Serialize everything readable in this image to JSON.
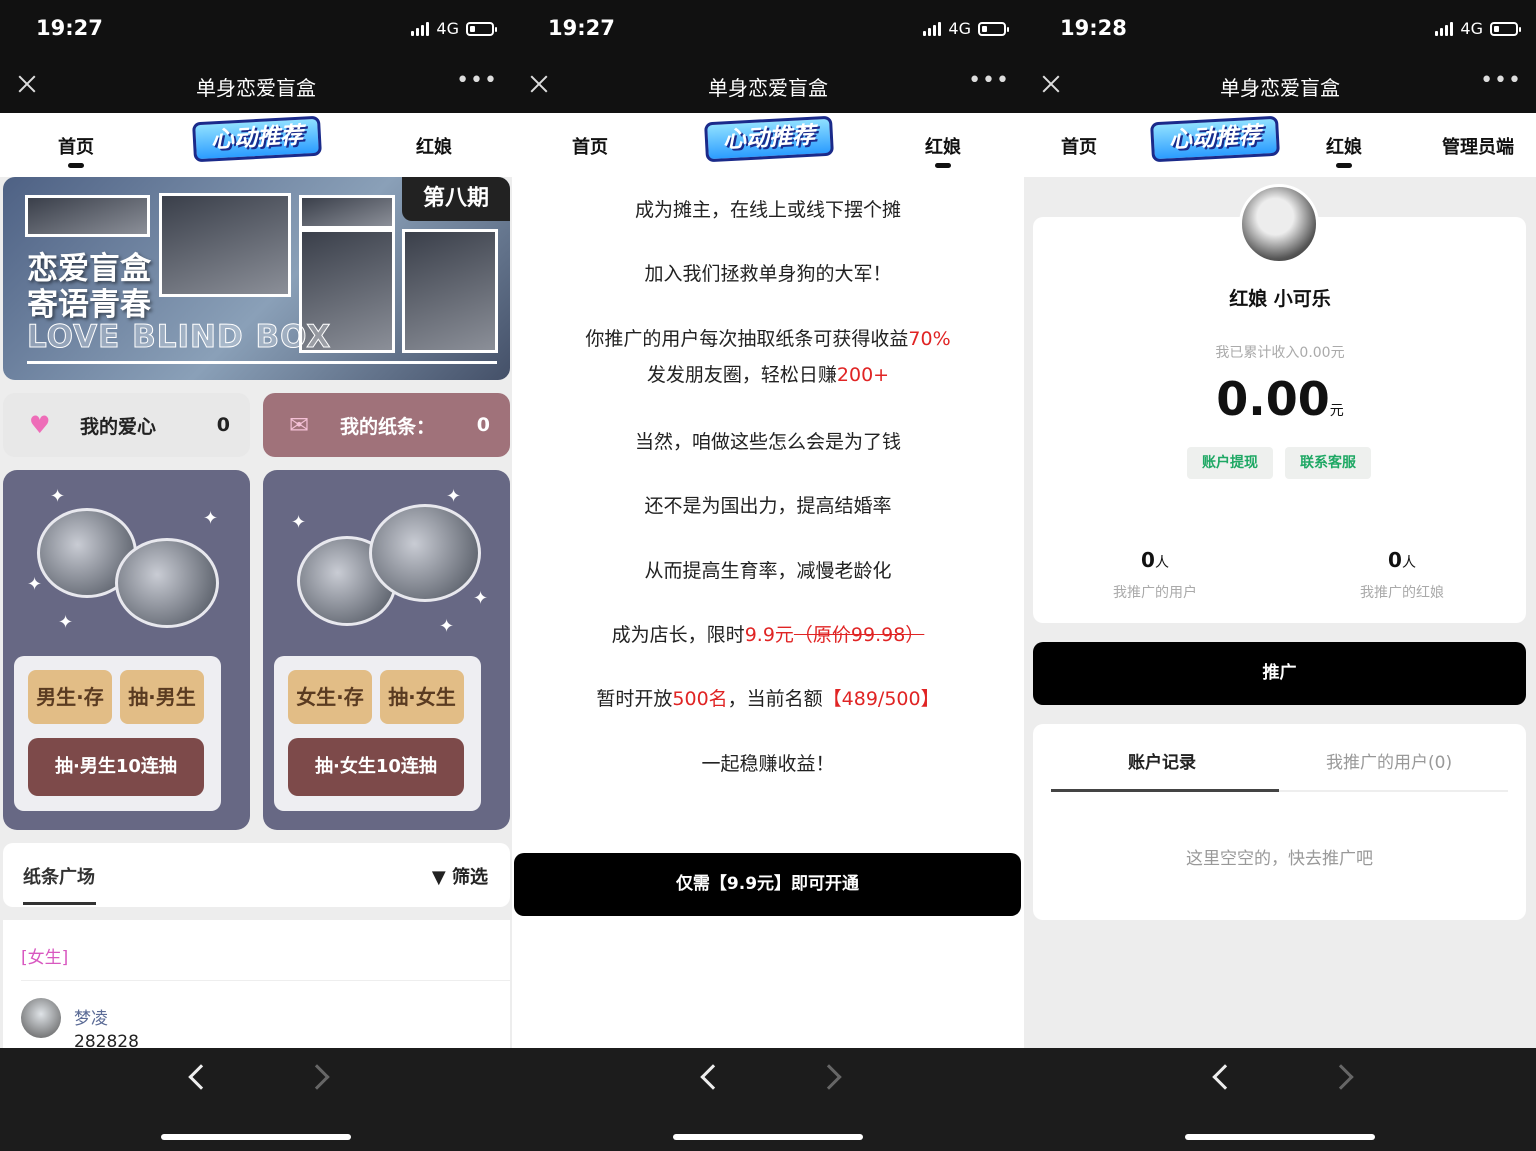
{
  "screens": [
    {
      "status": {
        "time": "19:27",
        "network": "4G"
      },
      "titlebar": {
        "title": "单身恋爱盲盒"
      },
      "tabs": {
        "home": "首页",
        "logo": "心动推荐",
        "matchmaker": "红娘"
      },
      "banner": {
        "issue": "第八期",
        "line1": "恋爱盲盒",
        "line2": "寄语青春",
        "english": "LOVE BLIND BOX"
      },
      "pills": {
        "love_label": "我的爱心",
        "love_count": "0",
        "note_label": "我的纸条：",
        "note_count": "0"
      },
      "male_card": {
        "store": "男生·存",
        "draw": "抽·男生",
        "draw10": "抽·男生10连抽"
      },
      "female_card": {
        "store": "女生·存",
        "draw": "抽·女生",
        "draw10": "抽·女生10连抽"
      },
      "square": {
        "label": "纸条广场",
        "filter": "筛选"
      },
      "feed": {
        "tag": "[女生]",
        "user": "梦凌",
        "user_id": "282828"
      }
    },
    {
      "status": {
        "time": "19:27",
        "network": "4G"
      },
      "titlebar": {
        "title": "单身恋爱盲盒"
      },
      "tabs": {
        "home": "首页",
        "logo": "心动推荐",
        "matchmaker": "红娘"
      },
      "content": {
        "p1": "成为摊主，在线上或线下摆个摊",
        "p2": "加入我们拯救单身狗的大军！",
        "p3a": "你推广的用户每次抽取纸条可获得收益",
        "p3b": "70%",
        "p4a": "发发朋友圈，轻松日赚",
        "p4b": "200+",
        "p5": "当然，咱做这些怎么会是为了钱",
        "p6": "还不是为国出力，提高结婚率",
        "p7": "从而提高生育率，减慢老龄化",
        "p8a": "成为店长，限时",
        "p8b": "9.9元",
        "p8c": "（原价99.98）",
        "p9a": "暂时开放",
        "p9b": "500名",
        "p9c": "，当前名额",
        "p9d": "【489/500】",
        "p10": "一起稳赚收益！"
      },
      "cta": "仅需【9.9元】即可开通"
    },
    {
      "status": {
        "time": "19:28",
        "network": "4G"
      },
      "titlebar": {
        "title": "单身恋爱盲盒"
      },
      "tabs": {
        "home": "首页",
        "logo": "心动推荐",
        "matchmaker": "红娘",
        "admin": "管理员端"
      },
      "profile": {
        "name": "红娘 小可乐",
        "income_label": "我已累计收入0.00元",
        "amount": "0.00",
        "unit": "元",
        "withdraw": "账户提现",
        "service": "联系客服"
      },
      "stats": [
        {
          "value": "0",
          "unit": "人",
          "label": "我推广的用户"
        },
        {
          "value": "0",
          "unit": "人",
          "label": "我推广的红娘"
        }
      ],
      "promote": "推广",
      "records": {
        "tab1": "账户记录",
        "tab2": "我推广的用户(0)",
        "empty": "这里空空的，快去推广吧"
      }
    }
  ],
  "colors": {
    "accent_red": "#e02424",
    "green": "#1ea864",
    "card_purple": "#676884",
    "note_pink": "#a0727a",
    "tag_pink": "#d858c0"
  }
}
